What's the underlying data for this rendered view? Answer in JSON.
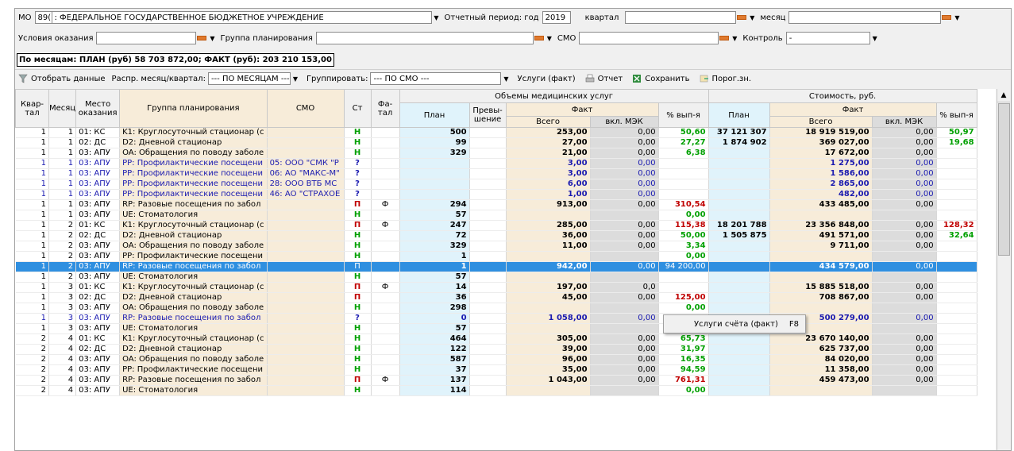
{
  "filters": {
    "mo_label": "МО",
    "mo_code": "89(",
    "mo_name": ": ФЕДЕРАЛЬНОЕ ГОСУДАРСТВЕННОЕ БЮДЖЕТНОЕ УЧРЕЖДЕНИЕ",
    "period_label": "Отчетный период: год",
    "year": "2019",
    "quarter_label": "квартал",
    "quarter_value": "",
    "month_label": "месяц",
    "month_value": "",
    "conditions_label": "Условия оказания",
    "conditions_value": "",
    "group_label": "Группа планирования",
    "group_value": "",
    "smo_label": "СМО",
    "smo_value": "",
    "control_label": "Контроль",
    "control_value": "-"
  },
  "summary": "По месяцам: ПЛАН (руб) 58 703 872,00; ФАКТ (руб): 203 210 153,00",
  "toolbar": {
    "select_data": "Отобрать данные",
    "distrib_label": "Распр. месяц/квартал:",
    "distrib_value": "--- ПО МЕСЯЦАМ ---",
    "group_by_label": "Группировать:",
    "group_by_value": "--- ПО СМО ---",
    "services_fact": "Услуги (факт)",
    "report": "Отчет",
    "save": "Сохранить",
    "threshold": "Порог.зн."
  },
  "table": {
    "headers": {
      "quarter": "Квар-тал",
      "month": "Месяц",
      "place": "Место оказания",
      "group": "Группа планирования",
      "smo": "СМО",
      "st": "Ст",
      "fatal": "Фа-тал",
      "volumes": "Объемы медицинских услуг",
      "plan": "План",
      "excess": "Превы-шение",
      "fact": "Факт",
      "total": "Всего",
      "incl_mek": "вкл. МЭК",
      "pct": "% вып-я",
      "cost": "Стоимость, руб.",
      "cost_plan": "План",
      "cost_fact": "Факт",
      "cost_total": "Всего",
      "cost_incl_mek": "вкл. МЭК",
      "cost_pct": "% вып-я"
    },
    "rows": [
      {
        "q": "1",
        "m": "1",
        "place": "01: КС",
        "group": "K1: Круглосуточный стационар (с",
        "smo": "",
        "st": "Н",
        "stc": "g",
        "fat": "",
        "plan": "500",
        "exc": "",
        "total": "253,00",
        "mek": "0,00",
        "pct": "50,60",
        "pctc": "g",
        "cplan": "37 121 307",
        "ctotal": "18 919 519,00",
        "cmek": "0,00",
        "cpct": "50,97",
        "cpctc": "g",
        "style": ""
      },
      {
        "q": "1",
        "m": "1",
        "place": "02: ДС",
        "group": "D2: Дневной стационар",
        "smo": "",
        "st": "Н",
        "stc": "g",
        "fat": "",
        "plan": "99",
        "exc": "",
        "total": "27,00",
        "mek": "0,00",
        "pct": "27,27",
        "pctc": "g",
        "cplan": "1 874 902",
        "ctotal": "369 027,00",
        "cmek": "0,00",
        "cpct": "19,68",
        "cpctc": "g",
        "style": ""
      },
      {
        "q": "1",
        "m": "1",
        "place": "03: АПУ",
        "group": "OA: Обращения по поводу заболе",
        "smo": "",
        "st": "Н",
        "stc": "g",
        "fat": "",
        "plan": "329",
        "exc": "",
        "total": "21,00",
        "mek": "0,00",
        "pct": "6,38",
        "pctc": "g",
        "cplan": "",
        "ctotal": "17 672,00",
        "cmek": "0,00",
        "cpct": "",
        "cpctc": "",
        "style": ""
      },
      {
        "q": "1",
        "m": "1",
        "place": "03: АПУ",
        "group": "PP: Профилактические посещени",
        "smo": "05: ООО \"СМК \"Р",
        "st": "?",
        "stc": "bl",
        "fat": "",
        "plan": "",
        "exc": "",
        "total": "3,00",
        "mek": "0,00",
        "pct": "",
        "pctc": "",
        "cplan": "",
        "ctotal": "1 275,00",
        "cmek": "0,00",
        "cpct": "",
        "cpctc": "",
        "style": "blue"
      },
      {
        "q": "1",
        "m": "1",
        "place": "03: АПУ",
        "group": "PP: Профилактические посещени",
        "smo": "06: АО \"МАКС-М\"",
        "st": "?",
        "stc": "bl",
        "fat": "",
        "plan": "",
        "exc": "",
        "total": "3,00",
        "mek": "0,00",
        "pct": "",
        "pctc": "",
        "cplan": "",
        "ctotal": "1 586,00",
        "cmek": "0,00",
        "cpct": "",
        "cpctc": "",
        "style": "blue"
      },
      {
        "q": "1",
        "m": "1",
        "place": "03: АПУ",
        "group": "PP: Профилактические посещени",
        "smo": "28: ООО ВТБ МС",
        "st": "?",
        "stc": "bl",
        "fat": "",
        "plan": "",
        "exc": "",
        "total": "6,00",
        "mek": "0,00",
        "pct": "",
        "pctc": "",
        "cplan": "",
        "ctotal": "2 865,00",
        "cmek": "0,00",
        "cpct": "",
        "cpctc": "",
        "style": "blue"
      },
      {
        "q": "1",
        "m": "1",
        "place": "03: АПУ",
        "group": "PP: Профилактические посещени",
        "smo": "46: АО \"СТРАХОЕ",
        "st": "?",
        "stc": "bl",
        "fat": "",
        "plan": "",
        "exc": "",
        "total": "1,00",
        "mek": "0,00",
        "pct": "",
        "pctc": "",
        "cplan": "",
        "ctotal": "482,00",
        "cmek": "0,00",
        "cpct": "",
        "cpctc": "",
        "style": "blue"
      },
      {
        "q": "1",
        "m": "1",
        "place": "03: АПУ",
        "group": "RP: Разовые посещения по забол",
        "smo": "",
        "st": "П",
        "stc": "rd",
        "fat": "Ф",
        "plan": "294",
        "exc": "",
        "total": "913,00",
        "mek": "0,00",
        "pct": "310,54",
        "pctc": "rd",
        "cplan": "",
        "ctotal": "433 485,00",
        "cmek": "0,00",
        "cpct": "",
        "cpctc": "",
        "style": ""
      },
      {
        "q": "1",
        "m": "1",
        "place": "03: АПУ",
        "group": "UE: Стоматология",
        "smo": "",
        "st": "Н",
        "stc": "g",
        "fat": "",
        "plan": "57",
        "exc": "",
        "total": "",
        "mek": "",
        "pct": "0,00",
        "pctc": "g",
        "cplan": "",
        "ctotal": "",
        "cmek": "",
        "cpct": "",
        "cpctc": "",
        "style": ""
      },
      {
        "q": "1",
        "m": "2",
        "place": "01: КС",
        "group": "K1: Круглосуточный стационар (с",
        "smo": "",
        "st": "П",
        "stc": "rd",
        "fat": "Ф",
        "plan": "247",
        "exc": "",
        "total": "285,00",
        "mek": "0,00",
        "pct": "115,38",
        "pctc": "rd",
        "cplan": "18 201 788",
        "ctotal": "23 356 848,00",
        "cmek": "0,00",
        "cpct": "128,32",
        "cpctc": "rd",
        "style": ""
      },
      {
        "q": "1",
        "m": "2",
        "place": "02: ДС",
        "group": "D2: Дневной стационар",
        "smo": "",
        "st": "Н",
        "stc": "g",
        "fat": "",
        "plan": "72",
        "exc": "",
        "total": "36,00",
        "mek": "0,00",
        "pct": "50,00",
        "pctc": "g",
        "cplan": "1 505 875",
        "ctotal": "491 571,00",
        "cmek": "0,00",
        "cpct": "32,64",
        "cpctc": "g",
        "style": ""
      },
      {
        "q": "1",
        "m": "2",
        "place": "03: АПУ",
        "group": "OA: Обращения по поводу заболе",
        "smo": "",
        "st": "Н",
        "stc": "g",
        "fat": "",
        "plan": "329",
        "exc": "",
        "total": "11,00",
        "mek": "0,00",
        "pct": "3,34",
        "pctc": "g",
        "cplan": "",
        "ctotal": "9 711,00",
        "cmek": "0,00",
        "cpct": "",
        "cpctc": "",
        "style": ""
      },
      {
        "q": "1",
        "m": "2",
        "place": "03: АПУ",
        "group": "PP: Профилактические посещени",
        "smo": "",
        "st": "Н",
        "stc": "g",
        "fat": "",
        "plan": "1",
        "exc": "",
        "total": "",
        "mek": "",
        "pct": "0,00",
        "pctc": "g",
        "cplan": "",
        "ctotal": "",
        "cmek": "",
        "cpct": "",
        "cpctc": "",
        "style": ""
      },
      {
        "q": "1",
        "m": "2",
        "place": "03: АПУ",
        "group": "RP: Разовые посещения по забол",
        "smo": "",
        "st": "П",
        "stc": "",
        "fat": "",
        "plan": "1",
        "exc": "",
        "total": "942,00",
        "mek": "0,00",
        "pct": "94 200,00",
        "pctc": "",
        "cplan": "",
        "ctotal": "434 579,00",
        "cmek": "0,00",
        "cpct": "",
        "cpctc": "",
        "style": "sel"
      },
      {
        "q": "1",
        "m": "2",
        "place": "03: АПУ",
        "group": "UE: Стоматология",
        "smo": "",
        "st": "Н",
        "stc": "g",
        "fat": "",
        "plan": "57",
        "exc": "",
        "total": "",
        "mek": "",
        "pct": "",
        "pctc": "",
        "cplan": "",
        "ctotal": "",
        "cmek": "",
        "cpct": "",
        "cpctc": "",
        "style": ""
      },
      {
        "q": "1",
        "m": "3",
        "place": "01: КС",
        "group": "K1: Круглосуточный стационар (с",
        "smo": "",
        "st": "П",
        "stc": "rd",
        "fat": "Ф",
        "plan": "14",
        "exc": "",
        "total": "197,00",
        "mek": "0,0",
        "pct": "",
        "pctc": "",
        "cplan": "",
        "ctotal": "15 885 518,00",
        "cmek": "0,00",
        "cpct": "",
        "cpctc": "",
        "style": ""
      },
      {
        "q": "1",
        "m": "3",
        "place": "02: ДС",
        "group": "D2: Дневной стационар",
        "smo": "",
        "st": "П",
        "stc": "rd",
        "fat": "",
        "plan": "36",
        "exc": "",
        "total": "45,00",
        "mek": "0,00",
        "pct": "125,00",
        "pctc": "rd",
        "cplan": "",
        "ctotal": "708 867,00",
        "cmek": "0,00",
        "cpct": "",
        "cpctc": "",
        "style": ""
      },
      {
        "q": "1",
        "m": "3",
        "place": "03: АПУ",
        "group": "OA: Обращения по поводу заболе",
        "smo": "",
        "st": "Н",
        "stc": "g",
        "fat": "",
        "plan": "298",
        "exc": "",
        "total": "",
        "mek": "",
        "pct": "0,00",
        "pctc": "g",
        "cplan": "",
        "ctotal": "",
        "cmek": "",
        "cpct": "",
        "cpctc": "",
        "style": ""
      },
      {
        "q": "1",
        "m": "3",
        "place": "03: АПУ",
        "group": "RP: Разовые посещения по забол",
        "smo": "",
        "st": "?",
        "stc": "bl",
        "fat": "",
        "plan": "0",
        "exc": "",
        "total": "1 058,00",
        "mek": "0,00",
        "pct": "",
        "pctc": "",
        "cplan": "",
        "ctotal": "500 279,00",
        "cmek": "0,00",
        "cpct": "",
        "cpctc": "",
        "style": "blue"
      },
      {
        "q": "1",
        "m": "3",
        "place": "03: АПУ",
        "group": "UE: Стоматология",
        "smo": "",
        "st": "Н",
        "stc": "g",
        "fat": "",
        "plan": "57",
        "exc": "",
        "total": "",
        "mek": "",
        "pct": "0,00",
        "pctc": "g",
        "cplan": "",
        "ctotal": "",
        "cmek": "",
        "cpct": "",
        "cpctc": "",
        "style": ""
      },
      {
        "q": "2",
        "m": "4",
        "place": "01: КС",
        "group": "K1: Круглосуточный стационар (с",
        "smo": "",
        "st": "Н",
        "stc": "g",
        "fat": "",
        "plan": "464",
        "exc": "",
        "total": "305,00",
        "mek": "0,00",
        "pct": "65,73",
        "pctc": "g",
        "cplan": "",
        "ctotal": "23 670 140,00",
        "cmek": "0,00",
        "cpct": "",
        "cpctc": "",
        "style": ""
      },
      {
        "q": "2",
        "m": "4",
        "place": "02: ДС",
        "group": "D2: Дневной стационар",
        "smo": "",
        "st": "Н",
        "stc": "g",
        "fat": "",
        "plan": "122",
        "exc": "",
        "total": "39,00",
        "mek": "0,00",
        "pct": "31,97",
        "pctc": "g",
        "cplan": "",
        "ctotal": "625 737,00",
        "cmek": "0,00",
        "cpct": "",
        "cpctc": "",
        "style": ""
      },
      {
        "q": "2",
        "m": "4",
        "place": "03: АПУ",
        "group": "OA: Обращения по поводу заболе",
        "smo": "",
        "st": "Н",
        "stc": "g",
        "fat": "",
        "plan": "587",
        "exc": "",
        "total": "96,00",
        "mek": "0,00",
        "pct": "16,35",
        "pctc": "g",
        "cplan": "",
        "ctotal": "84 020,00",
        "cmek": "0,00",
        "cpct": "",
        "cpctc": "",
        "style": ""
      },
      {
        "q": "2",
        "m": "4",
        "place": "03: АПУ",
        "group": "PP: Профилактические посещени",
        "smo": "",
        "st": "Н",
        "stc": "g",
        "fat": "",
        "plan": "37",
        "exc": "",
        "total": "35,00",
        "mek": "0,00",
        "pct": "94,59",
        "pctc": "g",
        "cplan": "",
        "ctotal": "11 358,00",
        "cmek": "0,00",
        "cpct": "",
        "cpctc": "",
        "style": ""
      },
      {
        "q": "2",
        "m": "4",
        "place": "03: АПУ",
        "group": "RP: Разовые посещения по забол",
        "smo": "",
        "st": "П",
        "stc": "rd",
        "fat": "Ф",
        "plan": "137",
        "exc": "",
        "total": "1 043,00",
        "mek": "0,00",
        "pct": "761,31",
        "pctc": "rd",
        "cplan": "",
        "ctotal": "459 473,00",
        "cmek": "0,00",
        "cpct": "",
        "cpctc": "",
        "style": ""
      },
      {
        "q": "2",
        "m": "4",
        "place": "03: АПУ",
        "group": "UE: Стоматология",
        "smo": "",
        "st": "Н",
        "stc": "g",
        "fat": "",
        "plan": "114",
        "exc": "",
        "total": "",
        "mek": "",
        "pct": "0,00",
        "pctc": "g",
        "cplan": "",
        "ctotal": "",
        "cmek": "",
        "cpct": "",
        "cpctc": "",
        "style": ""
      }
    ]
  },
  "context_menu": {
    "item_label": "Услуги счёта (факт)",
    "item_shortcut": "F8"
  },
  "colors": {
    "selected_row": "#2f8fe0",
    "status_ok": "#00a000",
    "status_over": "#c00000",
    "status_unknown": "#1a1ab0"
  }
}
